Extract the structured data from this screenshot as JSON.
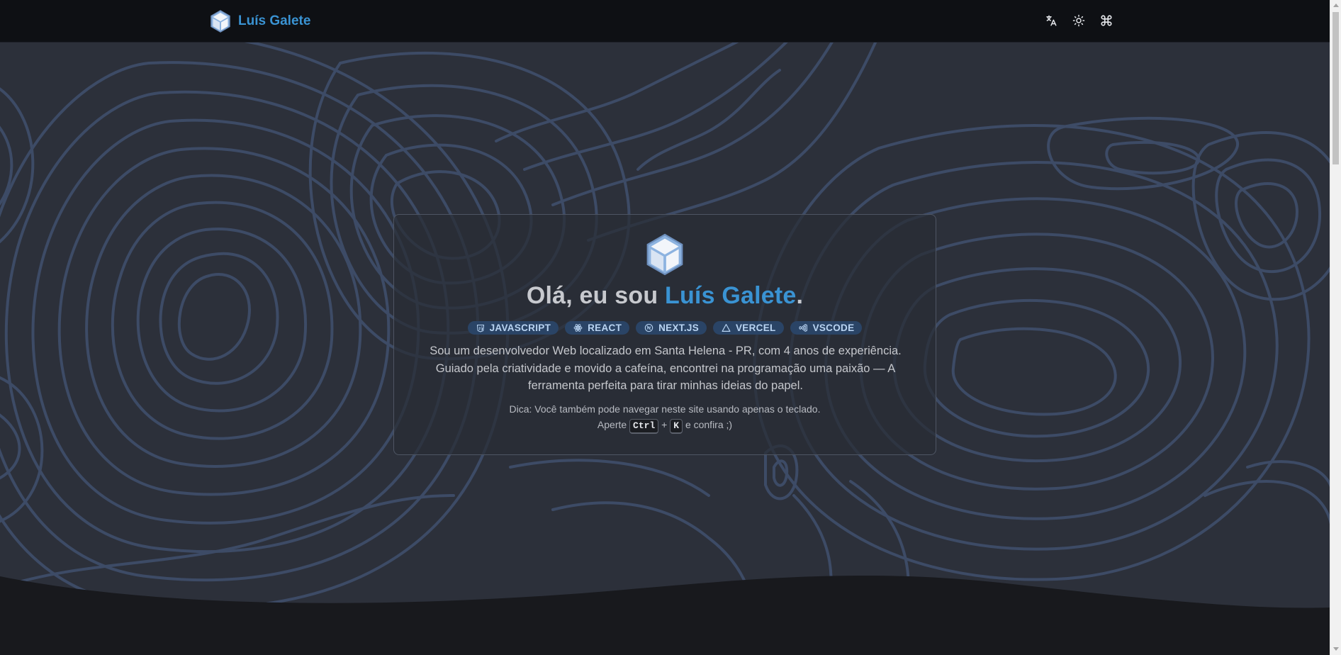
{
  "header": {
    "brand_name": "Luís Galete",
    "logo_icon": "cube-icon",
    "actions": [
      {
        "icon": "translate-icon"
      },
      {
        "icon": "sun-icon"
      },
      {
        "icon": "command-icon"
      }
    ]
  },
  "hero": {
    "logo_icon": "cube-icon",
    "greeting": "Olá, eu sou",
    "name": "Luís Galete",
    "name_suffix": ".",
    "badges": [
      {
        "label": "JAVASCRIPT",
        "icon": "javascript-icon"
      },
      {
        "label": "REACT",
        "icon": "react-icon"
      },
      {
        "label": "NEXT.JS",
        "icon": "nextjs-icon"
      },
      {
        "label": "VERCEL",
        "icon": "vercel-icon"
      },
      {
        "label": "VSCODE",
        "icon": "vscode-icon"
      }
    ],
    "bio": "Sou um desenvolvedor Web localizado em Santa Helena - PR, com 4 anos de experiência. Guiado pela criatividade e movido a cafeína, encontrei na programação uma paixão — A ferramenta perfeita para tirar minhas ideias do papel.",
    "tip_line1": "Dica: Você também pode navegar neste site usando apenas o teclado.",
    "tip_prefix": "Aperte",
    "key1": "Ctrl",
    "plus": "+",
    "key2": "K",
    "tip_suffix": "e confira ;)"
  },
  "colors": {
    "accent": "#3a93d3",
    "navbar_bg": "#0e1014",
    "hero_bg": "#2c303a",
    "topo_lines": "#3d4b66",
    "badge_bg": "#2a4466"
  }
}
